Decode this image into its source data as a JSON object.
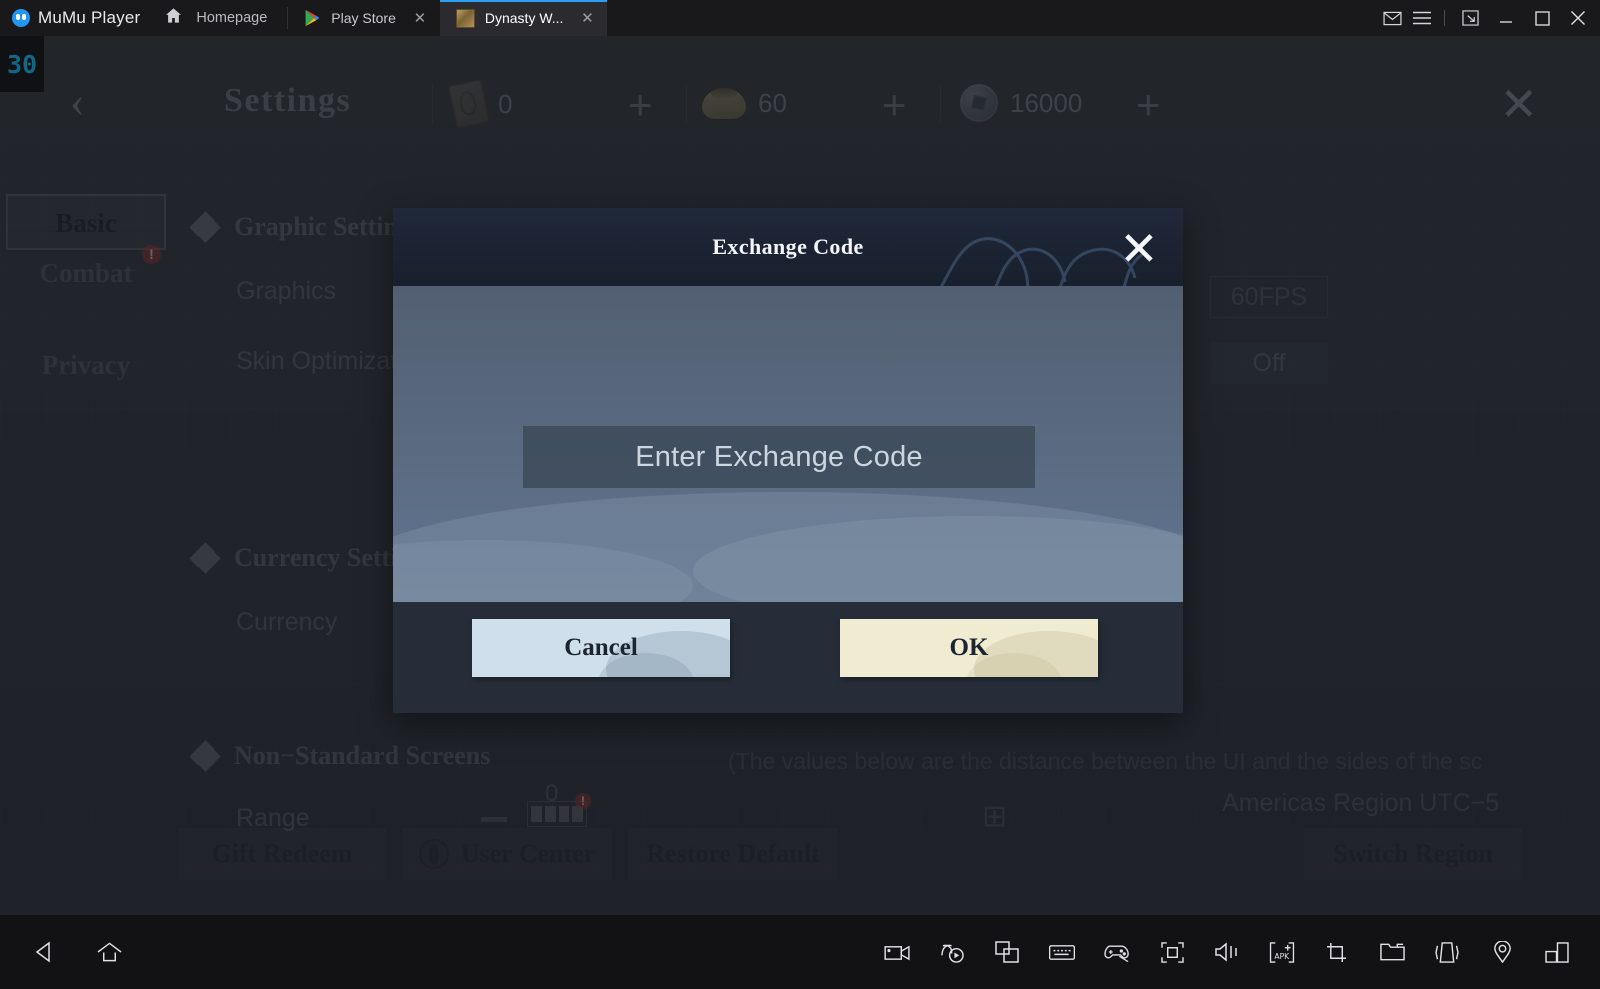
{
  "titlebar": {
    "brand": "MuMu Player",
    "brand_logo_icon": "mumu-logo-icon",
    "home_icon": "home-icon",
    "home_label": "Homepage",
    "tabs": [
      {
        "label": "Play Store",
        "icon": "play-store-icon",
        "close": "✕",
        "active": false
      },
      {
        "label": "Dynasty W...",
        "icon": "game-app-icon",
        "close": "✕",
        "active": true
      }
    ],
    "sys_buttons": [
      {
        "name": "mail-icon",
        "glyph": "✉"
      },
      {
        "name": "menu-icon",
        "glyph": "☰"
      },
      {
        "name": "resize-icon",
        "glyph": "⤡"
      },
      {
        "name": "minimize-icon",
        "glyph": "–"
      },
      {
        "name": "maximize-icon",
        "glyph": "□"
      },
      {
        "name": "close-icon",
        "glyph": "✕"
      }
    ]
  },
  "game": {
    "fps_badge": "30",
    "back_arrow": "‹",
    "title": "Settings",
    "close": "✕",
    "currencies": [
      {
        "name": "card",
        "icon": "card-icon",
        "value": "0",
        "plus": "+"
      },
      {
        "name": "ingot",
        "icon": "gold-ingot-icon",
        "value": "60",
        "plus": "+"
      },
      {
        "name": "coin",
        "icon": "copper-coin-icon",
        "value": "16000",
        "plus": "+"
      }
    ],
    "sidebar": [
      {
        "label": "Basic",
        "selected": true,
        "badge": ""
      },
      {
        "label": "Combat",
        "selected": false,
        "badge": "!"
      },
      {
        "label": "Privacy",
        "selected": false,
        "badge": ""
      }
    ],
    "sections": [
      {
        "title": "Graphic Settings"
      },
      {
        "title": "Currency Settings"
      },
      {
        "title": "Non−Standard Screens"
      }
    ],
    "rows": [
      {
        "label": "Graphics",
        "value": "60FPS",
        "style": "outline"
      },
      {
        "label": "Skin Optimization",
        "value": "Off",
        "style": "fill"
      },
      {
        "label": "Currency",
        "value": "",
        "style": "none"
      },
      {
        "label": "Range",
        "value": "0",
        "style": "stepper"
      }
    ],
    "note": "(The values below are the distance between the UI and the sides of the sc",
    "region_text": "Americas Region  UTC−5",
    "bottom_buttons": [
      {
        "label": "Gift Redeem",
        "icon": ""
      },
      {
        "label": "User Center",
        "icon": "user-icon"
      },
      {
        "label": "Restore Default",
        "icon": ""
      },
      {
        "label": "Switch Region",
        "icon": ""
      }
    ]
  },
  "dialog": {
    "title": "Exchange Code",
    "close_glyph": "✕",
    "input_placeholder": "Enter Exchange Code",
    "input_value": "",
    "cancel_label": "Cancel",
    "ok_label": "OK",
    "colors": {
      "header_bg": "#1b2332",
      "body_bg": "#5a6a80",
      "footer_bg": "#262d38",
      "cancel_bg": "#cfe0ec",
      "ok_bg": "#f0ecd2"
    }
  },
  "toolbar": {
    "left": [
      {
        "name": "android-back-icon"
      },
      {
        "name": "android-home-icon"
      }
    ],
    "right": [
      {
        "name": "video-record-icon"
      },
      {
        "name": "macro-record-icon"
      },
      {
        "name": "multi-instance-icon"
      },
      {
        "name": "keyboard-mapping-icon"
      },
      {
        "name": "gamepad-icon"
      },
      {
        "name": "fullscreen-icon"
      },
      {
        "name": "volume-icon"
      },
      {
        "name": "install-apk-icon"
      },
      {
        "name": "screenshot-icon"
      },
      {
        "name": "shared-folder-icon"
      },
      {
        "name": "shake-icon"
      },
      {
        "name": "location-icon"
      },
      {
        "name": "window-layout-icon"
      }
    ]
  }
}
